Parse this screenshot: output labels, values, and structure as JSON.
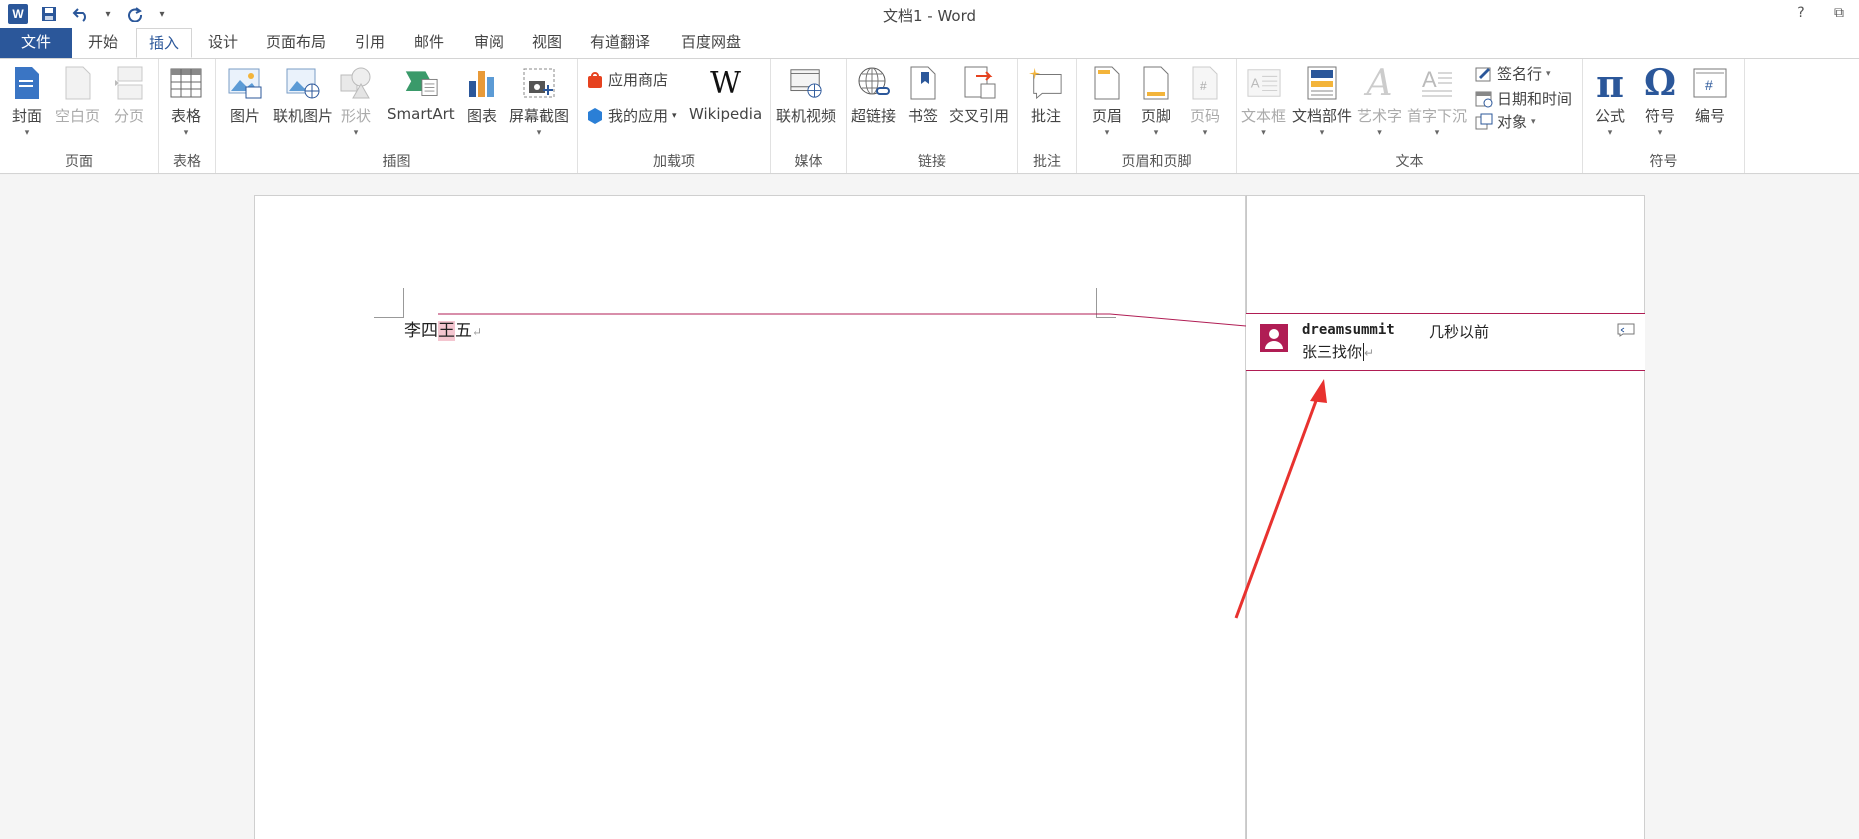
{
  "titlebar": {
    "title": "文档1 - Word",
    "help": "?",
    "restore": "⧉"
  },
  "tabs": [
    "文件",
    "开始",
    "插入",
    "设计",
    "页面布局",
    "引用",
    "邮件",
    "审阅",
    "视图",
    "有道翻译",
    "百度网盘"
  ],
  "ribbon": {
    "pages": {
      "label": "页面",
      "cover": "封面",
      "blank": "空白页",
      "break": "分页"
    },
    "tables": {
      "label": "表格",
      "table": "表格"
    },
    "illustrations": {
      "label": "插图",
      "picture": "图片",
      "online_picture": "联机图片",
      "shapes": "形状",
      "smartart": "SmartArt",
      "chart": "图表",
      "screenshot": "屏幕截图"
    },
    "addins": {
      "label": "加载项",
      "store": "应用商店",
      "myapps": "我的应用",
      "wikipedia": "Wikipedia"
    },
    "media": {
      "label": "媒体",
      "online_video": "联机视频"
    },
    "links": {
      "label": "链接",
      "hyperlink": "超链接",
      "bookmark": "书签",
      "crossref": "交叉引用"
    },
    "comments": {
      "label": "批注",
      "comment": "批注"
    },
    "header_footer": {
      "label": "页眉和页脚",
      "header": "页眉",
      "footer": "页脚",
      "page_number": "页码"
    },
    "text": {
      "label": "文本",
      "textbox": "文本框",
      "quickparts": "文档部件",
      "wordart": "艺术字",
      "dropcap": "首字下沉",
      "signature": "签名行",
      "datetime": "日期和时间",
      "object": "对象"
    },
    "symbols": {
      "label": "符号",
      "equation": "公式",
      "symbol": "符号",
      "number": "编号"
    }
  },
  "document": {
    "text_before": "李四",
    "text_highlight": "王",
    "text_after": "五",
    "para_mark": "↵"
  },
  "comment": {
    "author": "dreamsummit",
    "time": "几秒以前",
    "text": "张三找你",
    "para_mark": "↵"
  },
  "colors": {
    "accent": "#2b579a",
    "comment": "#b01d54",
    "arrow": "#e8322f"
  }
}
